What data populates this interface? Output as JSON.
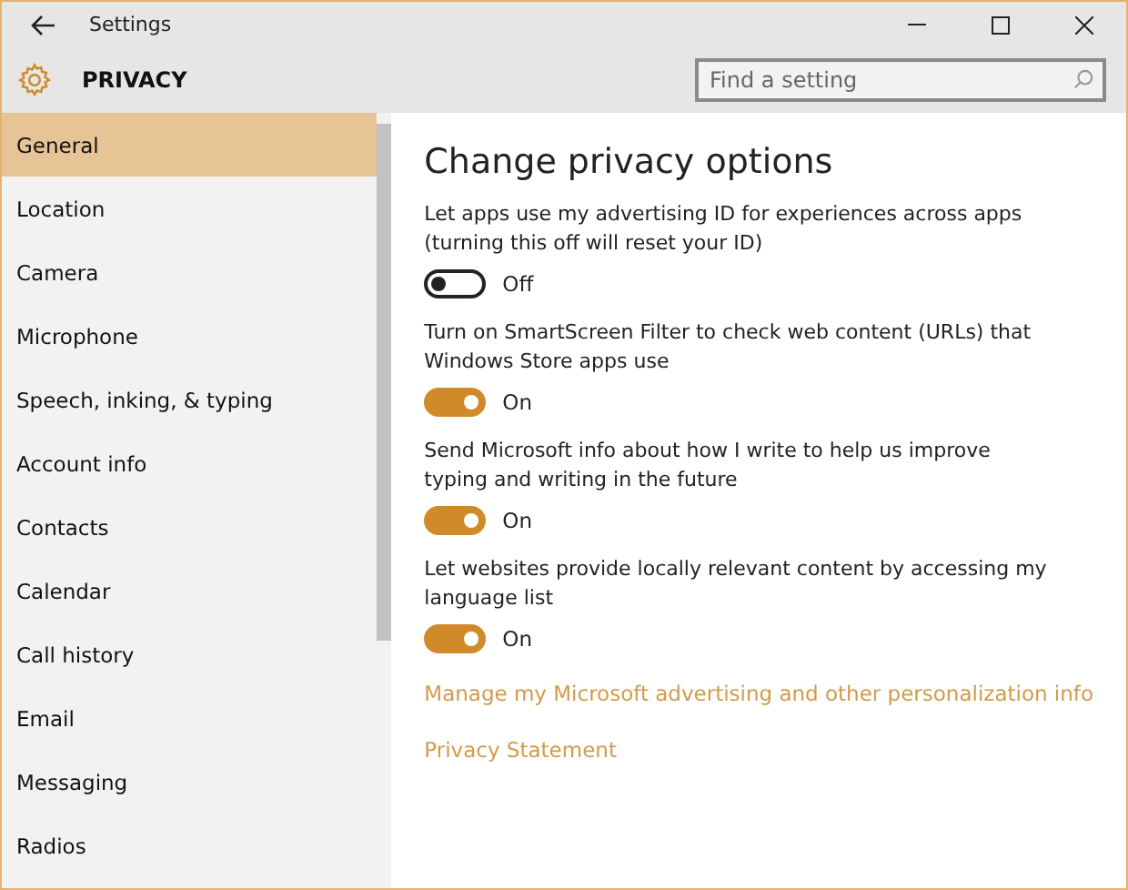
{
  "window": {
    "title": "Settings"
  },
  "header": {
    "title": "PRIVACY",
    "search": {
      "placeholder": "Find a setting"
    }
  },
  "sidebar": {
    "items": [
      {
        "label": "General",
        "selected": true
      },
      {
        "label": "Location",
        "selected": false
      },
      {
        "label": "Camera",
        "selected": false
      },
      {
        "label": "Microphone",
        "selected": false
      },
      {
        "label": "Speech, inking, & typing",
        "selected": false
      },
      {
        "label": "Account info",
        "selected": false
      },
      {
        "label": "Contacts",
        "selected": false
      },
      {
        "label": "Calendar",
        "selected": false
      },
      {
        "label": "Call history",
        "selected": false
      },
      {
        "label": "Email",
        "selected": false
      },
      {
        "label": "Messaging",
        "selected": false
      },
      {
        "label": "Radios",
        "selected": false
      }
    ]
  },
  "content": {
    "title": "Change privacy options",
    "settings": [
      {
        "label": "Let apps use my advertising ID for experiences across apps (turning this off will reset your ID)",
        "on": false,
        "state": "Off"
      },
      {
        "label": "Turn on SmartScreen Filter to check web content (URLs) that Windows Store apps use",
        "on": true,
        "state": "On"
      },
      {
        "label": "Send Microsoft info about how I write to help us improve typing and writing in the future",
        "on": true,
        "state": "On"
      },
      {
        "label": "Let websites provide locally relevant content by accessing my language list",
        "on": true,
        "state": "On"
      }
    ],
    "links": [
      "Manage my Microsoft advertising and other personalization info",
      "Privacy Statement"
    ]
  }
}
